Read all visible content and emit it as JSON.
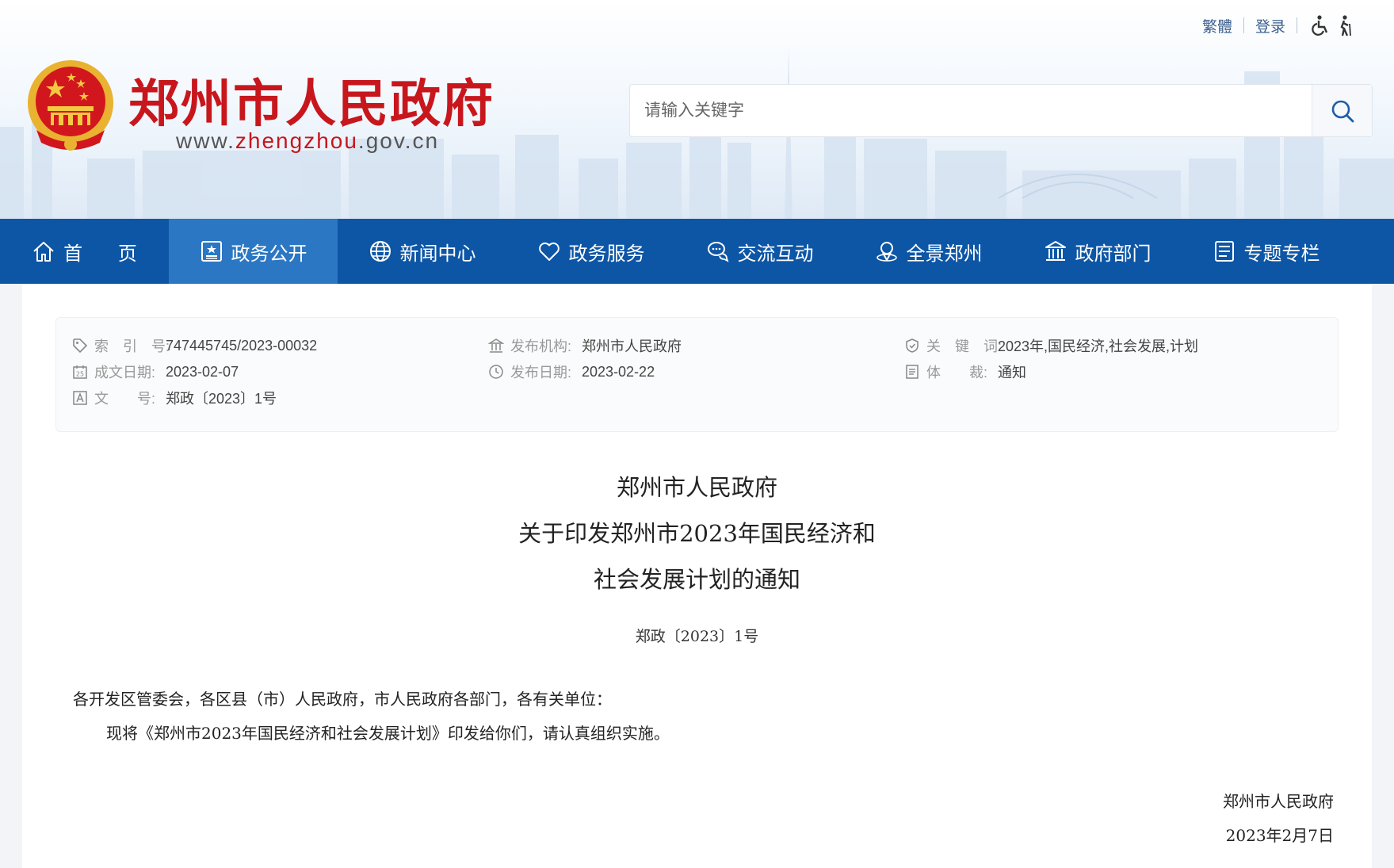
{
  "top_links": {
    "traditional": "繁體",
    "login": "登录",
    "accessibility_icon": "wheelchair-icon",
    "elder_icon": "elder-icon"
  },
  "site": {
    "title": "郑州市人民政府",
    "url_prefix": "www.",
    "url_highlight": "zhengzhou",
    "url_suffix": ".gov.cn",
    "brand_color": "#c8161d"
  },
  "search": {
    "placeholder": "请输入关键字",
    "icon": "search-icon"
  },
  "nav": {
    "color": "#0d56a6",
    "active_color": "#2b77c3",
    "items": [
      {
        "label": "首 页",
        "icon": "home-icon"
      },
      {
        "label": "政务公开",
        "icon": "gov-open-icon",
        "active": true
      },
      {
        "label": "新闻中心",
        "icon": "globe-icon"
      },
      {
        "label": "政务服务",
        "icon": "heart-icon"
      },
      {
        "label": "交流互动",
        "icon": "chat-icon"
      },
      {
        "label": "全景郑州",
        "icon": "panorama-icon"
      },
      {
        "label": "政府部门",
        "icon": "building-icon"
      },
      {
        "label": "专题专栏",
        "icon": "topic-icon"
      }
    ]
  },
  "meta": {
    "index_label": "索　引　号:",
    "index_value": "747445745/2023-00032",
    "issuer_label": "发布机构:",
    "issuer_value": "郑州市人民政府",
    "keywords_label": "关　键　词:",
    "keywords_value": "2023年,国民经济,社会发展,计划",
    "created_label": "成文日期:",
    "created_value": "2023-02-07",
    "published_label": "发布日期:",
    "published_value": "2023-02-22",
    "genre_label": "体　　裁:",
    "genre_value": "通知",
    "docno_label": "文　　号:",
    "docno_value": "郑政〔2023〕1号"
  },
  "document": {
    "title_line1": "郑州市人民政府",
    "title_line2": "关于印发郑州市2023年国民经济和",
    "title_line3": "社会发展计划的通知",
    "doc_number": "郑政〔2023〕1号",
    "salutation": "各开发区管委会，各区县（市）人民政府，市人民政府各部门，各有关单位：",
    "body": "现将《郑州市2023年国民经济和社会发展计划》印发给你们，请认真组织实施。",
    "signature": "郑州市人民政府",
    "date": "2023年2月7日"
  }
}
